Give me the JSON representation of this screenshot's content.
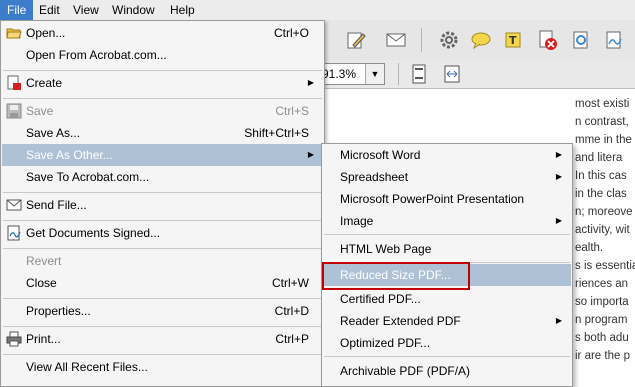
{
  "menubar": [
    "File",
    "Edit",
    "View",
    "Window",
    "Help"
  ],
  "zoom": {
    "value": "91.3%"
  },
  "doc_lines": [
    "most existi",
    "n contrast,",
    "mme in the",
    "and litera",
    "In this cas",
    "in the clas",
    "n; moreove",
    "activity, wit",
    "ealth.",
    "s is essentia",
    "riences an",
    "so importa",
    "n program",
    "s both adu",
    "ir are the p"
  ],
  "file_menu": [
    {
      "label": "Open...",
      "shortcut": "Ctrl+O",
      "icon": "open-folder-icon"
    },
    {
      "label": "Open From Acrobat.com..."
    },
    {
      "label": "Create",
      "submenu": true,
      "icon": "create-pdf-icon"
    },
    {
      "label": "Save",
      "shortcut": "Ctrl+S",
      "disabled": true,
      "icon": "save-icon"
    },
    {
      "label": "Save As...",
      "shortcut": "Shift+Ctrl+S"
    },
    {
      "label": "Save As Other...",
      "submenu": true,
      "highlighted": true
    },
    {
      "label": "Save To Acrobat.com..."
    },
    {
      "label": "Send File...",
      "icon": "envelope-icon"
    },
    {
      "label": "Get Documents Signed...",
      "icon": "sign-doc-icon"
    },
    {
      "label": "Revert",
      "disabled": true
    },
    {
      "label": "Close",
      "shortcut": "Ctrl+W"
    },
    {
      "label": "Properties...",
      "shortcut": "Ctrl+D"
    },
    {
      "label": "Print...",
      "shortcut": "Ctrl+P",
      "icon": "printer-icon"
    },
    {
      "label": "View All Recent Files..."
    }
  ],
  "save_as_other_menu": [
    {
      "label": "Microsoft Word",
      "submenu": true
    },
    {
      "label": "Spreadsheet",
      "submenu": true
    },
    {
      "label": "Microsoft PowerPoint Presentation"
    },
    {
      "label": "Image",
      "submenu": true
    },
    {
      "label": "HTML Web Page"
    },
    {
      "label": "Reduced Size PDF...",
      "highlighted": true
    },
    {
      "label": "Certified PDF..."
    },
    {
      "label": "Reader Extended PDF",
      "submenu": true
    },
    {
      "label": "Optimized PDF..."
    },
    {
      "label": "Archivable PDF (PDF/A)"
    }
  ],
  "colors": {
    "menu_highlight": "#aec1d5",
    "menubar_active": "#3d7cc9",
    "callout_red": "#c00000"
  }
}
